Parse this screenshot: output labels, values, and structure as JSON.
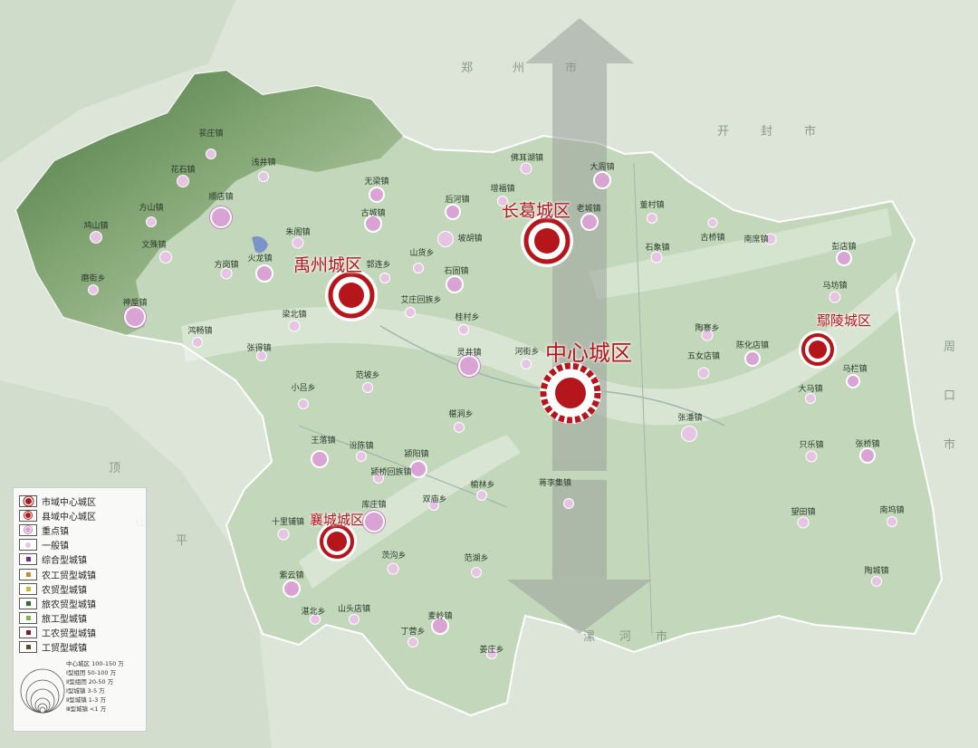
{
  "colors": {
    "city_core": "#b5161c",
    "key_town": "#d9a3d3",
    "general_town": "#e7c4e4",
    "terrain": "#4c7b42",
    "plain": "#c8dcc0"
  },
  "background_labels": [
    "郑",
    "州",
    "市",
    "开",
    "封",
    "市",
    "周",
    "口",
    "市",
    "漯",
    "河",
    "市",
    "平",
    "顶",
    "山"
  ],
  "urban_areas": [
    {
      "name": "中心城区",
      "type": "市域中心城区"
    },
    {
      "name": "长葛城区",
      "type": "县域中心城区"
    },
    {
      "name": "禹州城区",
      "type": "县域中心城区"
    },
    {
      "name": "鄢陵城区",
      "type": "县域中心城区"
    },
    {
      "name": "襄城城区",
      "type": "县域中心城区"
    }
  ],
  "towns": [
    "苌庄镇",
    "浅井镇",
    "花石镇",
    "无梁镇",
    "顺店镇",
    "方山镇",
    "古城镇",
    "朱阁镇",
    "鸠山镇",
    "文殊镇",
    "火龙镇",
    "方岗镇",
    "郭连乡",
    "山货乡",
    "磨街乡",
    "神垕镇",
    "梁北镇",
    "艾庄回族乡",
    "鸿畅镇",
    "张得镇",
    "佛耳湖镇",
    "后河镇",
    "增福镇",
    "坡胡镇",
    "大周镇",
    "老城镇",
    "董村镇",
    "石固镇",
    "石象镇",
    "古桥镇",
    "南席镇",
    "彭店镇",
    "马坊镇",
    "桂村乡",
    "陶寨乡",
    "灵井镇",
    "河街乡",
    "五女店镇",
    "陈化店镇",
    "马栏镇",
    "大马镇",
    "小吕乡",
    "范坡乡",
    "椹涧乡",
    "张潘镇",
    "只乐镇",
    "张桥镇",
    "王落镇",
    "汾陈镇",
    "颍阳镇",
    "颍桥回族镇",
    "双庙乡",
    "榆林乡",
    "蒋李集镇",
    "望田镇",
    "南坞镇",
    "十里铺镇",
    "库庄镇",
    "茨沟乡",
    "姜庄乡",
    "紫云镇",
    "湛北乡",
    "山头店镇",
    "范湖乡",
    "麦岭镇",
    "丁营乡",
    "陶城镇"
  ],
  "legend": {
    "items": [
      "市域中心城区",
      "县域中心城区",
      "重点镇",
      "一般镇",
      "综合型城镇",
      "农工贸型城镇",
      "农贸型城镇",
      "旅农贸型城镇",
      "旅工型城镇",
      "工农贸型城镇",
      "工贸型城镇"
    ],
    "type_colors": [
      "#6b2f93",
      "#c98a3a",
      "#c9b93a",
      "#2f6b2f",
      "#7fb44a",
      "#7a1e2a",
      "#5a4a2a"
    ],
    "scale": [
      "中心城区 100-150 万",
      "Ⅰ型组团 50-100 万",
      "Ⅱ型组团 20-50 万",
      "Ⅰ型城镇 3-5 万",
      "Ⅱ型城镇 1-3 万",
      "Ⅲ型城镇 <1 万"
    ]
  }
}
